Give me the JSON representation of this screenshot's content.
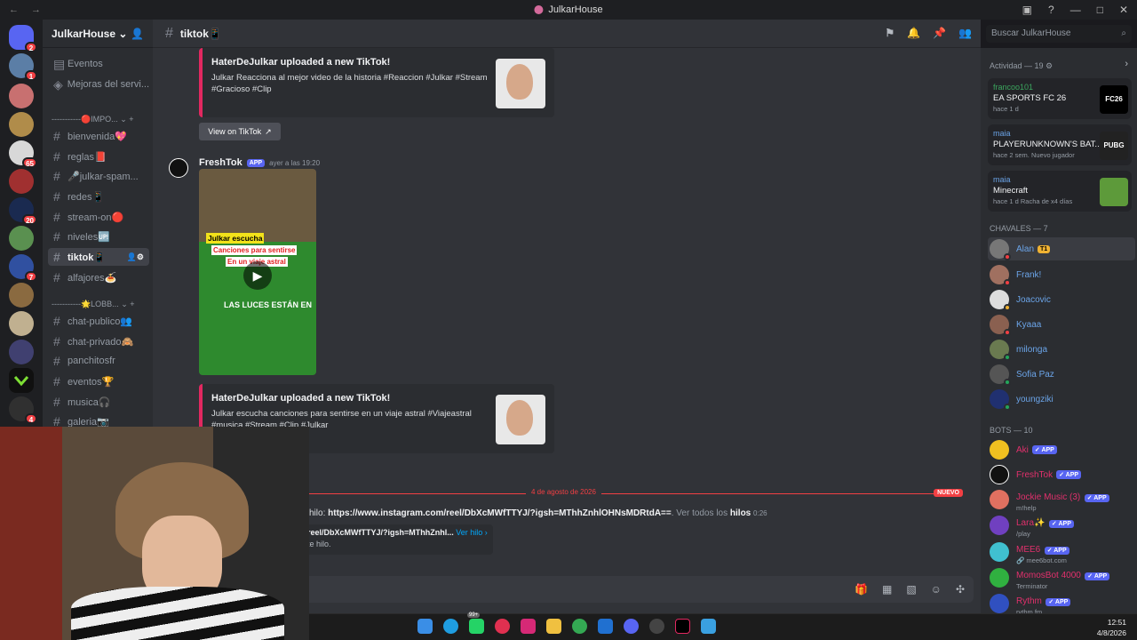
{
  "window": {
    "title": "JulkarHouse"
  },
  "server": {
    "name": "JulkarHouse"
  },
  "guild_badges": [
    "2",
    "1",
    "65",
    "20",
    "7",
    "4"
  ],
  "sidebar": {
    "top_items": [
      {
        "label": "Eventos"
      },
      {
        "label": "Mejoras del servi..."
      }
    ],
    "categories": [
      {
        "label": "-----------🔴IMPO..."
      },
      {
        "label": "-----------🌟LOBB..."
      }
    ],
    "channels": [
      {
        "label": "bienvenida💖"
      },
      {
        "label": "reglas📕"
      },
      {
        "label": "🎤julkar-spam..."
      },
      {
        "label": "redes📱"
      },
      {
        "label": "stream-on🔴"
      },
      {
        "label": "niveles🆙"
      },
      {
        "label": "tiktok📱"
      },
      {
        "label": "alfajores🍝"
      },
      {
        "label": "chat-publico👥"
      },
      {
        "label": "chat-privado🙈"
      },
      {
        "label": "panchitosfr"
      },
      {
        "label": "eventos🏆"
      },
      {
        "label": "musica🎧"
      },
      {
        "label": "galeria📷"
      }
    ]
  },
  "channel": {
    "name": "tiktok📱"
  },
  "search": {
    "placeholder": "Buscar JulkarHouse"
  },
  "messages": {
    "embed1": {
      "title": "HaterDeJulkar uploaded a new TikTok!",
      "desc": "Julkar Reacciona al mejor video de la historia #Reaccion #Julkar #Stream #Gracioso #Clip"
    },
    "view_button": "View on TikTok",
    "bot_name": "FreshTok",
    "app_tag": "APP",
    "time": "ayer a las 19:20",
    "video_caption": [
      "Julkar escucha",
      "Canciones para sentirse",
      "En un viaje astral"
    ],
    "video_overlay": "LAS LUCES ESTÁN EN",
    "embed2": {
      "title": "HaterDeJulkar uploaded a new TikTok!",
      "desc": "Julkar escucha canciones para sentirse en un viaje astral #Viajeastral #musica #Stream #Clip #Julkar"
    },
    "divider_date": "4 de agosto de 2026",
    "new_tag": "NUEVO",
    "thread_prefix": "hilo:",
    "thread_link": "https://www.instagram.com/reel/DbXcMWfTTYJ/?igsh=MThhZnhlOHNsMDRtdA==",
    "thread_suffix": ". Ver todos los",
    "thread_word": "hilos",
    "thread_time": "0:26",
    "thread_box_title": "reel/DbXcMWfTTYJ/?igsh=MThhZnhl...",
    "thread_box_link": "Ver hilo ›",
    "thread_box_desc": "te hilo."
  },
  "activity": {
    "title": "Actividad — 19",
    "cards": [
      {
        "user": "francoo101",
        "game": "EA SPORTS FC 26",
        "meta": "hace 1 d",
        "icon_text": "FC26"
      },
      {
        "user": "maia",
        "game": "PLAYERUNKNOWN'S BAT...",
        "meta": "hace 2 sem.  Nuevo jugador",
        "icon_text": "PUBG"
      },
      {
        "user": "maia",
        "game": "Minecraft",
        "meta": "hace 1 d   Racha de x4 días",
        "icon_text": ""
      }
    ]
  },
  "members": {
    "group1": "CHAVALES — 7",
    "list": [
      {
        "name": "Alan",
        "tag": "T1"
      },
      {
        "name": "Frank!"
      },
      {
        "name": "Joacovic"
      },
      {
        "name": "Kyaaa"
      },
      {
        "name": "milonga"
      },
      {
        "name": "Sofia Paz"
      },
      {
        "name": "youngziki"
      }
    ],
    "group2": "BOTS — 10",
    "bots": [
      {
        "name": "Aki",
        "sub": ""
      },
      {
        "name": "FreshTok",
        "sub": ""
      },
      {
        "name": "Jockie Music (3)",
        "sub": "m!help"
      },
      {
        "name": "Lara✨",
        "sub": "/play"
      },
      {
        "name": "MEE6",
        "sub": "🔗 mee6bot.com"
      },
      {
        "name": "MomosBot 4000",
        "sub": "Terminator"
      },
      {
        "name": "Rythm",
        "sub": "rythm.fm"
      }
    ]
  },
  "taskbar": {
    "time": "12:51",
    "date": "4/8/2026",
    "badge": "99+"
  },
  "colors": {
    "accent": "#5865f2",
    "tiktok": "#e22860",
    "danger": "#f23f43"
  }
}
